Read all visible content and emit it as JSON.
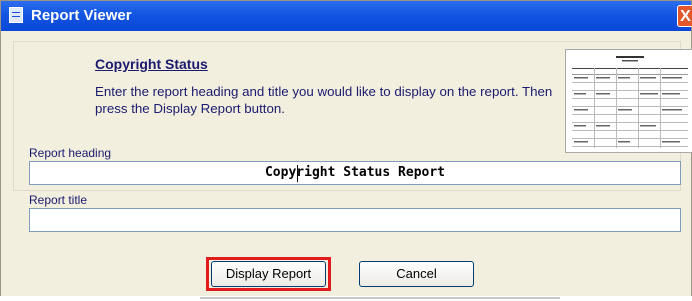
{
  "window": {
    "title": "Report Viewer",
    "close_label": "X"
  },
  "intro": {
    "heading": "Copyright Status",
    "instructions": "Enter the report heading and title you would like to display on the report. Then press the Display Report button."
  },
  "preview": {
    "icon": "report-preview-thumbnail"
  },
  "fields": {
    "report_heading_label": "Report heading",
    "report_heading_value": "Copyright Status Report",
    "report_title_label": "Report title",
    "report_title_value": ""
  },
  "buttons": {
    "display_report": "Display Report",
    "cancel": "Cancel"
  },
  "colors": {
    "titlebar": "#0a47d8",
    "highlight": "#e21c1c",
    "text": "#1a1a6e"
  }
}
